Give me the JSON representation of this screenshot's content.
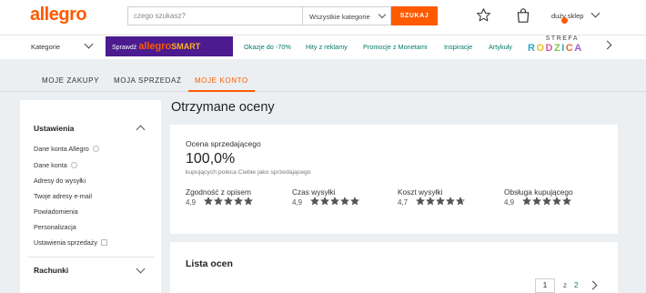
{
  "header": {
    "logo": "allegro",
    "search_placeholder": "czego szukasz?",
    "category_select": "Wszystkie kategorie",
    "search_button": "SZUKAJ",
    "user_name": "duży sklep"
  },
  "nav": {
    "categories": "Kategorie",
    "smart_banner": {
      "prefix": "Sprawdź",
      "brand": "allegro",
      "suffix": "SMART"
    },
    "links": [
      "Okazje do -70%",
      "Hity z reklamy",
      "Promocje z Monetami",
      "Inspiracje",
      "Artykuły"
    ],
    "strefa": {
      "line1": "STREFA",
      "line2": "RODZICA"
    }
  },
  "tabs": [
    {
      "label": "MOJE ZAKUPY",
      "active": false
    },
    {
      "label": "MOJA SPRZEDAŻ",
      "active": false
    },
    {
      "label": "MOJE KONTO",
      "active": true
    }
  ],
  "sidebar": {
    "section_title": "Ustawienia",
    "items": [
      "Dane konta Allegro",
      "Dane konta",
      "Adresy do wysyłki",
      "Twoje adresy e-mail",
      "Powiadomienia",
      "Personalizacja",
      "Ustawienia sprzedaży"
    ],
    "section2_title": "Rachunki"
  },
  "main": {
    "title": "Otrzymane oceny",
    "rating_label": "Ocena sprzedającego",
    "rating_value": "100,0%",
    "rating_sub": "kupujących poleca Ciebie jako sprzedającego",
    "metrics": [
      {
        "name": "Zgodność z opisem",
        "value": "4,9",
        "stars": 4.9
      },
      {
        "name": "Czas wysyłki",
        "value": "4,9",
        "stars": 4.9
      },
      {
        "name": "Koszt wysyłki",
        "value": "4,7",
        "stars": 4.7
      },
      {
        "name": "Obsługa kupującego",
        "value": "4,9",
        "stars": 4.9
      }
    ],
    "list_title": "Lista ocen",
    "pagination": {
      "current": "1",
      "of": "z",
      "total": "2"
    }
  },
  "colors": {
    "accent": "#ff5a00",
    "link": "#007a6b",
    "smart_bg": "#4b1b8f",
    "star": "#555555"
  }
}
